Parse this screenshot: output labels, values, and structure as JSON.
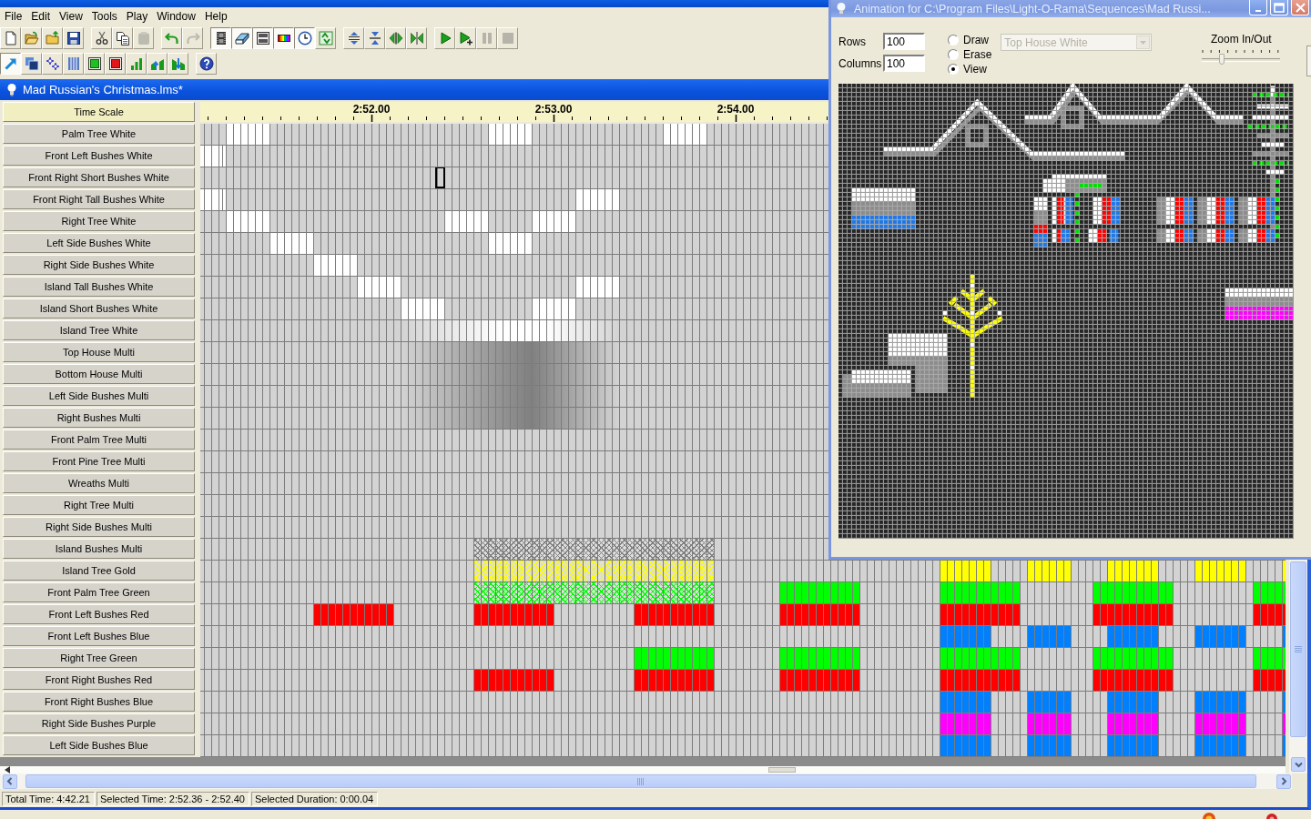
{
  "menu": [
    "File",
    "Edit",
    "View",
    "Tools",
    "Play",
    "Window",
    "Help"
  ],
  "toolbars": [
    {
      "buttons": [
        {
          "pressed": false,
          "disabled": false
        },
        {
          "pressed": false,
          "disabled": false
        },
        {
          "pressed": false,
          "disabled": false
        },
        {
          "pressed": false,
          "disabled": false
        },
        {
          "pressed": false,
          "disabled": false
        },
        {
          "pressed": false,
          "disabled": false
        },
        {
          "pressed": false,
          "disabled": true
        },
        {
          "pressed": false,
          "disabled": false
        },
        {
          "pressed": false,
          "disabled": true
        },
        {
          "pressed": true,
          "disabled": false
        },
        {
          "pressed": true,
          "disabled": false
        },
        {
          "pressed": true,
          "disabled": false
        },
        {
          "pressed": true,
          "disabled": false
        },
        {
          "pressed": true,
          "disabled": false
        },
        {
          "pressed": false,
          "disabled": false
        },
        {
          "pressed": false,
          "disabled": false
        },
        {
          "pressed": false,
          "disabled": false
        },
        {
          "pressed": false,
          "disabled": false
        },
        {
          "pressed": false,
          "disabled": false
        },
        {
          "pressed": false,
          "disabled": false
        },
        {
          "pressed": false,
          "disabled": false
        },
        {
          "pressed": false,
          "disabled": true
        },
        {
          "pressed": false,
          "disabled": true
        }
      ]
    },
    {
      "buttons": [
        {
          "pressed": true,
          "disabled": false
        },
        {
          "pressed": false,
          "disabled": false
        },
        {
          "pressed": false,
          "disabled": false
        },
        {
          "pressed": false,
          "disabled": false
        },
        {
          "pressed": false,
          "disabled": false
        },
        {
          "pressed": false,
          "disabled": false
        },
        {
          "pressed": false,
          "disabled": false
        },
        {
          "pressed": false,
          "disabled": false
        },
        {
          "pressed": false,
          "disabled": false
        },
        {
          "pressed": false,
          "disabled": false
        }
      ]
    }
  ],
  "sequence": {
    "title": "Mad Russian's Christmas.lms*",
    "time_scale": {
      "label": "Time Scale",
      "ticks": [
        "2:52.00",
        "2:53.00",
        "2:54.00"
      ]
    },
    "channels": [
      {
        "name": "Palm Tree White",
        "color": "#ffffff",
        "selected": false,
        "events": [
          {
            "kind": "on"
          },
          {
            "kind": "on"
          },
          {
            "kind": "on"
          }
        ]
      },
      {
        "name": "Front Left Bushes White",
        "color": "#ffffff",
        "selected": false,
        "events": [
          {
            "kind": "on"
          }
        ]
      },
      {
        "name": "Front Right Short Bushes White",
        "selected": true
      },
      {
        "name": "Front Right Tall Bushes White",
        "color": "#ffffff",
        "selected": false,
        "events": [
          {
            "kind": "on"
          },
          {
            "kind": "on"
          }
        ]
      },
      {
        "name": "Right Tree White",
        "color": "#ffffff",
        "selected": false,
        "events": [
          {
            "kind": "on"
          },
          {
            "kind": "on"
          },
          {
            "kind": "on"
          }
        ]
      },
      {
        "name": "Left Side Bushes White",
        "color": "#ffffff",
        "selected": false,
        "events": [
          {
            "kind": "on"
          },
          {
            "kind": "on"
          }
        ]
      },
      {
        "name": "Right Side Bushes White",
        "color": "#ffffff",
        "selected": false,
        "events": [
          {
            "kind": "on"
          }
        ]
      },
      {
        "name": "Island Tall Bushes White",
        "color": "#ffffff",
        "selected": false,
        "events": [
          {
            "kind": "on"
          },
          {
            "kind": "on"
          }
        ]
      },
      {
        "name": "Island Short Bushes White",
        "color": "#ffffff",
        "selected": false,
        "events": [
          {
            "kind": "on"
          },
          {
            "kind": "on"
          }
        ]
      },
      {
        "name": "Island Tree White",
        "color": "#ffffff",
        "selected": false,
        "events": [
          {
            "kind": "fade_up"
          },
          {
            "kind": "on"
          },
          {
            "kind": "fade_down"
          }
        ]
      },
      {
        "name": "Top House Multi",
        "color": "#808080",
        "selected": false,
        "events": [
          {
            "kind": "fade_up"
          },
          {
            "kind": "fade_down"
          }
        ]
      },
      {
        "name": "Bottom House Multi",
        "color": "#808080",
        "selected": false,
        "events": [
          {
            "kind": "fade_up"
          },
          {
            "kind": "fade_down"
          }
        ]
      },
      {
        "name": "Left Side Bushes Multi",
        "color": "#808080",
        "selected": false,
        "events": [
          {
            "kind": "fade_up"
          },
          {
            "kind": "fade_down"
          }
        ]
      },
      {
        "name": "Right Bushes Multi",
        "color": "#808080",
        "selected": false,
        "events": [
          {
            "kind": "fade_up"
          },
          {
            "kind": "fade_down"
          }
        ]
      },
      {
        "name": "Front Palm Tree Multi",
        "selected": false
      },
      {
        "name": "Front Pine Tree Multi",
        "selected": false
      },
      {
        "name": "Wreaths Multi",
        "selected": false
      },
      {
        "name": "Right Tree Multi",
        "selected": false
      },
      {
        "name": "Right Side Bushes Multi",
        "selected": false
      },
      {
        "name": "Island Bushes Multi",
        "color": "#808080",
        "selected": false,
        "events": [
          {
            "kind": "twinkle"
          }
        ]
      },
      {
        "name": "Island Tree Gold",
        "color": "#ffff00",
        "selected": false,
        "events": [
          {
            "kind": "twinkle"
          },
          {
            "kind": "on"
          },
          {
            "kind": "on"
          },
          {
            "kind": "on"
          },
          {
            "kind": "on"
          },
          {
            "kind": "on"
          }
        ]
      },
      {
        "name": "Front Palm Tree Green",
        "color": "#00ff00",
        "selected": false,
        "events": [
          {
            "kind": "twinkle"
          },
          {
            "kind": "on"
          },
          {
            "kind": "on"
          },
          {
            "kind": "on"
          },
          {
            "kind": "on"
          }
        ]
      },
      {
        "name": "Front Left Bushes Red",
        "color": "#ff0000",
        "selected": false,
        "events": [
          {
            "kind": "on"
          },
          {
            "kind": "on"
          },
          {
            "kind": "on"
          },
          {
            "kind": "on"
          },
          {
            "kind": "on"
          },
          {
            "kind": "on"
          },
          {
            "kind": "on"
          }
        ]
      },
      {
        "name": "Front Left Bushes Blue",
        "color": "#0080ff",
        "selected": false,
        "events": [
          {
            "kind": "on"
          },
          {
            "kind": "on"
          },
          {
            "kind": "on"
          },
          {
            "kind": "on"
          },
          {
            "kind": "on"
          }
        ]
      },
      {
        "name": "Right Tree Green",
        "color": "#00ff00",
        "selected": false,
        "events": [
          {
            "kind": "on"
          },
          {
            "kind": "on"
          },
          {
            "kind": "on"
          },
          {
            "kind": "on"
          },
          {
            "kind": "on"
          }
        ]
      },
      {
        "name": "Front Right Bushes Red",
        "color": "#ff0000",
        "selected": false,
        "events": [
          {
            "kind": "on"
          },
          {
            "kind": "on"
          },
          {
            "kind": "on"
          },
          {
            "kind": "on"
          },
          {
            "kind": "on"
          },
          {
            "kind": "on"
          }
        ]
      },
      {
        "name": "Front Right Bushes Blue",
        "color": "#0080ff",
        "selected": false,
        "events": [
          {
            "kind": "on"
          },
          {
            "kind": "on"
          },
          {
            "kind": "on"
          },
          {
            "kind": "on"
          },
          {
            "kind": "on"
          }
        ]
      },
      {
        "name": "Right Side Bushes Purple",
        "color": "#ff00ff",
        "selected": false,
        "events": [
          {
            "kind": "on"
          },
          {
            "kind": "on"
          },
          {
            "kind": "on"
          },
          {
            "kind": "on"
          },
          {
            "kind": "on"
          }
        ]
      },
      {
        "name": "Left Side Bushes Blue",
        "color": "#0080ff",
        "selected": false,
        "events": [
          {
            "kind": "on"
          },
          {
            "kind": "on"
          },
          {
            "kind": "on"
          },
          {
            "kind": "on"
          },
          {
            "kind": "on"
          }
        ]
      }
    ]
  },
  "status_bar": [
    "Total Time: 4:42.21",
    "Selected Time: 2:52.36 - 2:52.40",
    "Selected Duration: 0:00.04"
  ],
  "animation_window": {
    "title": "Animation for C:\\Program Files\\Light-O-Rama\\Sequences\\Mad Russi...",
    "rows": {
      "label": "Rows",
      "value": "100"
    },
    "columns": {
      "label": "Columns",
      "value": "100"
    },
    "modes": [
      {
        "label": "Draw",
        "selected": false
      },
      {
        "label": "Erase",
        "selected": false
      },
      {
        "label": "View",
        "selected": true
      }
    ],
    "channel_select": {
      "value": "Top House White",
      "disabled": true
    },
    "zoom": {
      "label": "Zoom In/Out",
      "level": 0.25
    }
  }
}
